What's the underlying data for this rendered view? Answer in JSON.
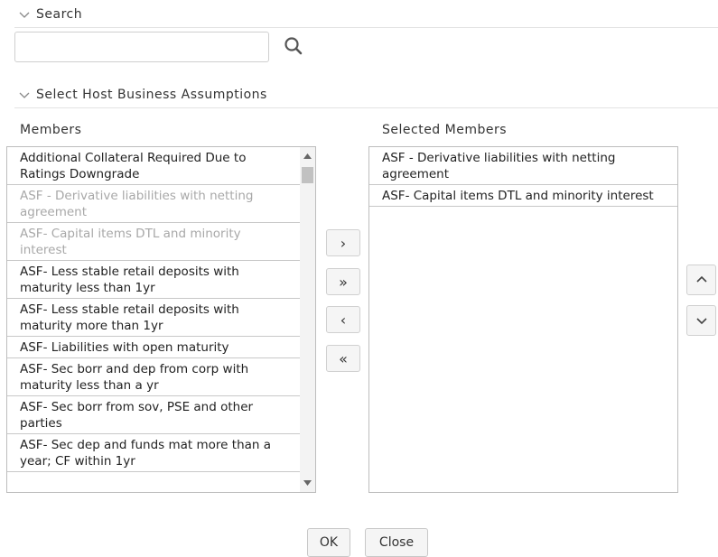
{
  "search": {
    "header": "Search",
    "input_value": "",
    "input_placeholder": ""
  },
  "assumptions": {
    "header": "Select Host Business Assumptions"
  },
  "members": {
    "label": "Members",
    "items": [
      {
        "label": "Additional Collateral Required Due to\nRatings Downgrade",
        "disabled": false
      },
      {
        "label": "ASF - Derivative liabilities with netting\nagreement",
        "disabled": true
      },
      {
        "label": "ASF- Capital items DTL and minority\ninterest",
        "disabled": true
      },
      {
        "label": "ASF- Less stable retail deposits with\nmaturity less than 1yr",
        "disabled": false
      },
      {
        "label": "ASF- Less stable retail deposits with\nmaturity more than 1yr",
        "disabled": false
      },
      {
        "label": "ASF- Liabilities with open maturity",
        "disabled": false
      },
      {
        "label": "ASF- Sec borr and dep from corp with\nmaturity less than a yr",
        "disabled": false
      },
      {
        "label": "ASF- Sec borr from sov, PSE and other\nparties",
        "disabled": false
      },
      {
        "label": "ASF- Sec dep and funds mat more than a\nyear; CF within 1yr",
        "disabled": false
      }
    ]
  },
  "selected_members": {
    "label": "Selected Members",
    "items": [
      {
        "label": "ASF - Derivative liabilities with netting\nagreement"
      },
      {
        "label": "ASF- Capital items DTL and minority interest"
      }
    ]
  },
  "shuttle": {
    "move_label": "›",
    "move_all_label": "»",
    "remove_label": "‹",
    "remove_all_label": "«"
  },
  "footer": {
    "ok_label": "OK",
    "close_label": "Close"
  },
  "icons": {
    "section_collapse": "chevron-down-icon",
    "search": "search-icon",
    "move_up": "chevron-up-icon",
    "move_down": "chevron-down-icon"
  }
}
